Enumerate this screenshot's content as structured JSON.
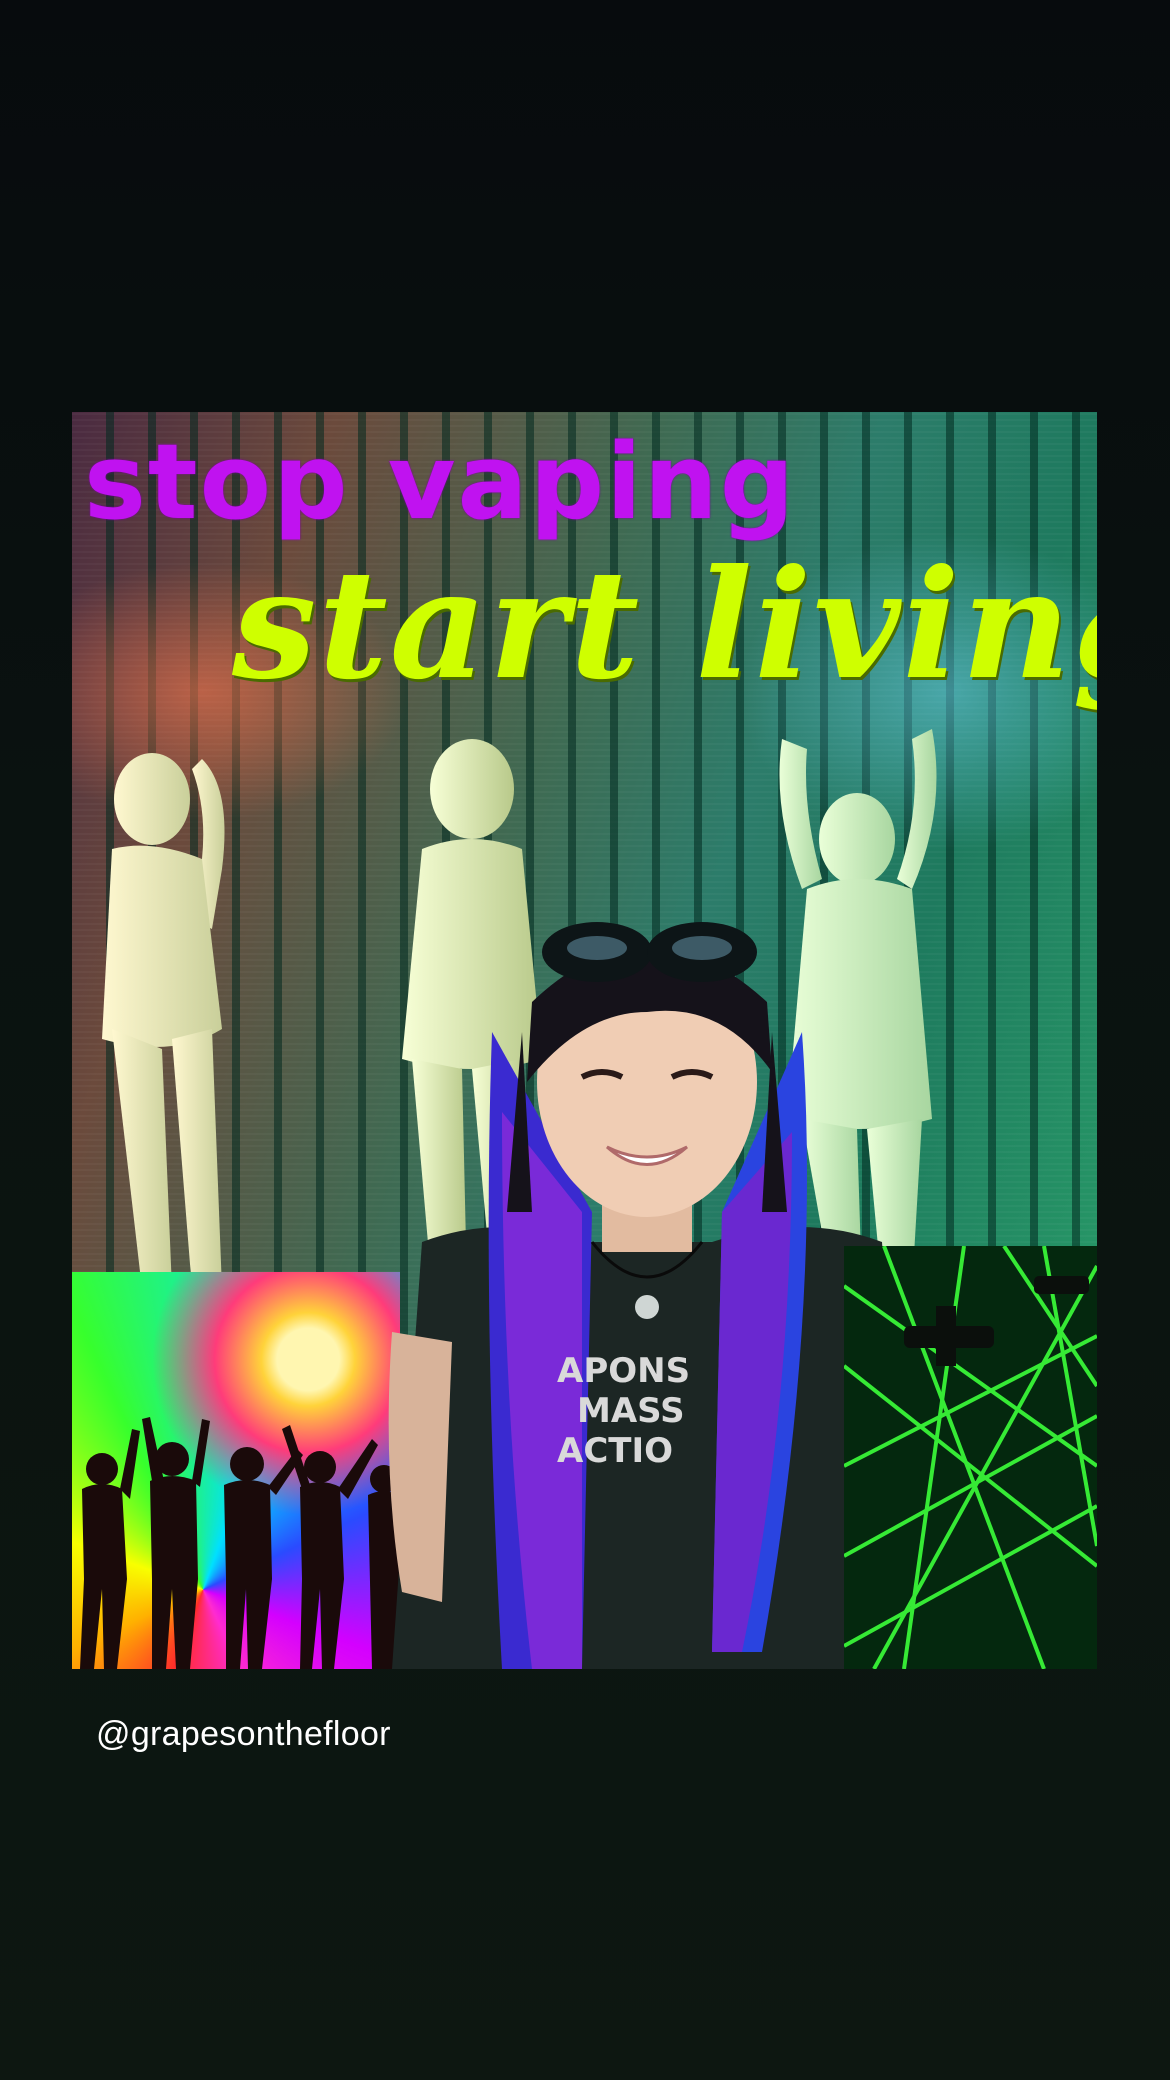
{
  "poster": {
    "headline_top": "stop vaping",
    "headline_bottom": "start living"
  },
  "caption": {
    "handle": "@grapesonthefloor"
  },
  "colors": {
    "headline_top": "#c012f0",
    "headline_bottom": "#cfff00",
    "background": "#0a1210",
    "handle_text": "#ffffff"
  }
}
